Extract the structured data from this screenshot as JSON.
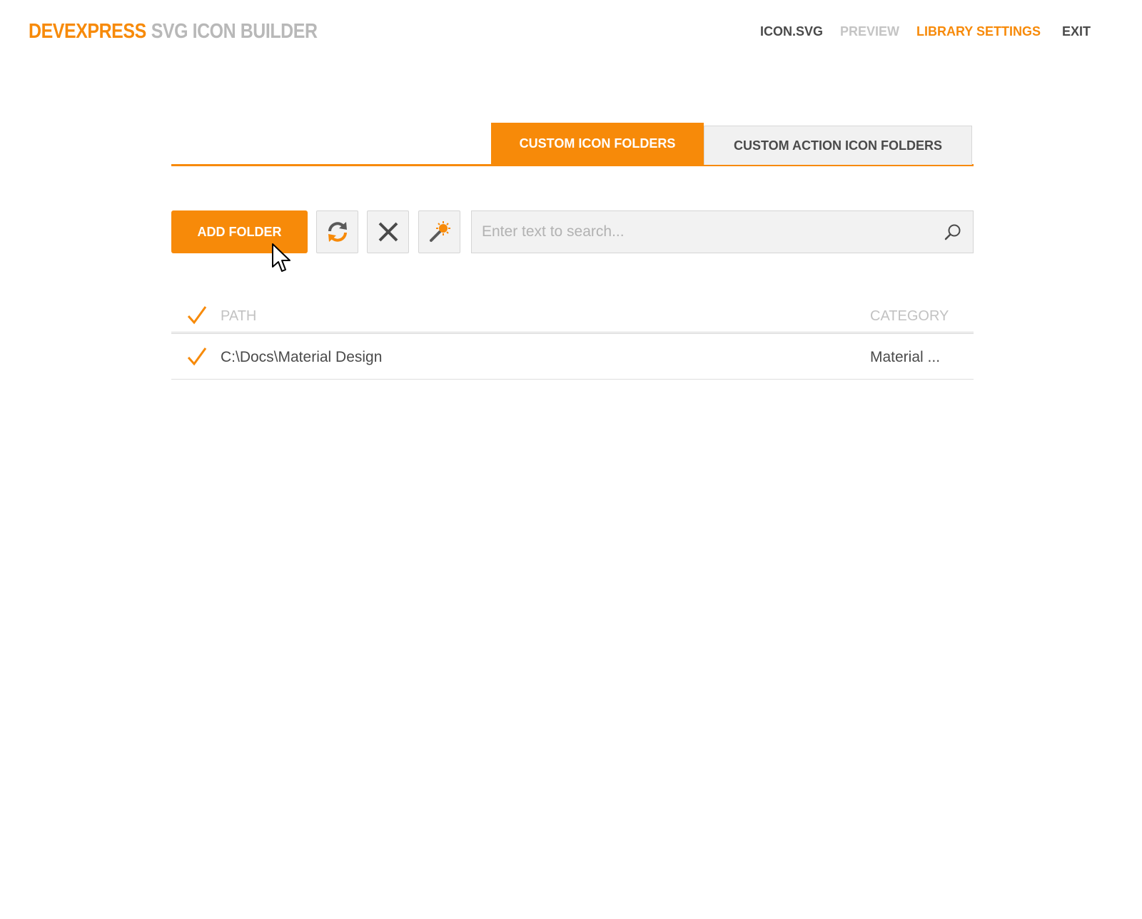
{
  "header": {
    "brand_primary": "DEVEXPRESS",
    "brand_secondary": "SVG ICON BUILDER",
    "nav": {
      "icon_svg": "ICON.SVG",
      "preview": "PREVIEW",
      "library_settings": "LIBRARY SETTINGS",
      "exit": "EXIT"
    }
  },
  "tabs": [
    {
      "label": "CUSTOM ICON FOLDERS",
      "active": true
    },
    {
      "label": "CUSTOM ACTION ICON FOLDERS",
      "active": false
    }
  ],
  "toolbar": {
    "add_folder_label": "ADD FOLDER",
    "icons": [
      "refresh-icon",
      "delete-icon",
      "magic-wand-icon"
    ],
    "search_placeholder": "Enter text to search..."
  },
  "grid": {
    "columns": {
      "path": "PATH",
      "category": "CATEGORY"
    },
    "rows": [
      {
        "checked": true,
        "path": "C:\\Docs\\Material Design",
        "category": "Material ..."
      }
    ]
  },
  "colors": {
    "accent": "#f78a09",
    "muted_text": "#c2c2c2",
    "dark_text": "#4a4a4a",
    "button_bg": "#f2f2f2"
  }
}
